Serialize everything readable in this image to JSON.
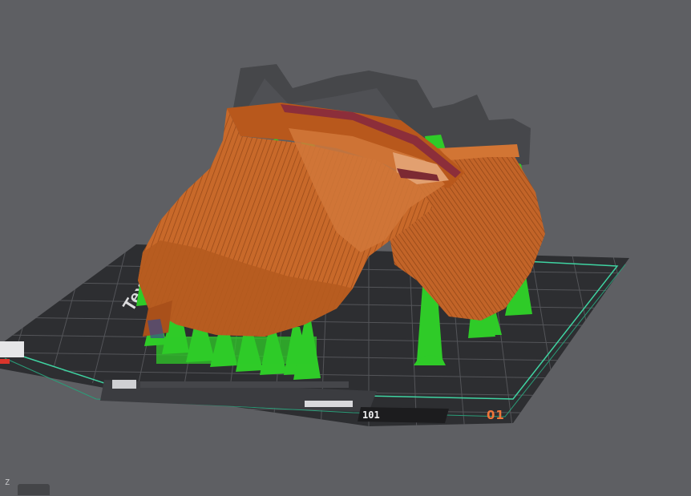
{
  "viewport": {
    "axis_label": "Z",
    "plate_number": "01",
    "plate_text": "Textured PEI Plate",
    "plate_marker": "101",
    "colors": {
      "background": "#5e5f63",
      "plate": "#2d2e31",
      "grid": "#545559",
      "plate_border": "#3fd4a2",
      "model": "#c8692a",
      "model_dark": "#9a4a18",
      "support": "#2fcb28",
      "accent": "#f0763a"
    },
    "icons": [
      "bed-grid-icon",
      "model-icon",
      "support-icon"
    ]
  }
}
